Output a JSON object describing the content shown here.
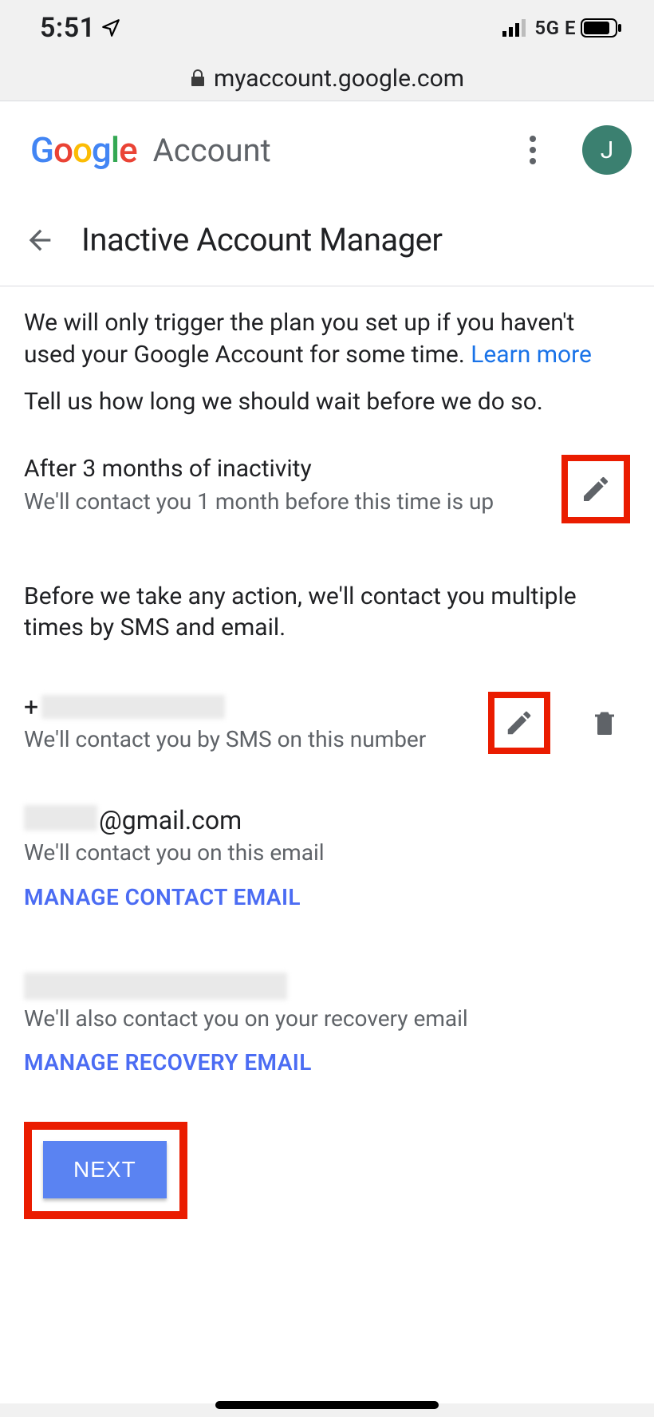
{
  "status": {
    "time": "5:51",
    "network": "5G E"
  },
  "url": {
    "domain": "myaccount.google.com"
  },
  "header": {
    "product_word": "Account",
    "avatar_initial": "J"
  },
  "page": {
    "title": "Inactive Account Manager"
  },
  "intro": {
    "line1": "We will only trigger the plan you set up if you haven't used your Google Account for some time. ",
    "learn_more": "Learn more",
    "line2": "Tell us how long we should wait before we do so."
  },
  "inactivity": {
    "heading": "After 3 months of inactivity",
    "sub": "We'll contact you 1 month before this time is up"
  },
  "contact_intro": "Before we take any action, we'll contact you multiple times by SMS and email.",
  "phone": {
    "prefix": "+",
    "sub": "We'll contact you by SMS on this number"
  },
  "email": {
    "domain_part": "@gmail.com",
    "sub": "We'll contact you on this email",
    "manage_label": "MANAGE CONTACT EMAIL"
  },
  "recovery": {
    "sub": "We'll also contact you on your recovery email",
    "manage_label": "MANAGE RECOVERY EMAIL"
  },
  "actions": {
    "next": "NEXT"
  }
}
